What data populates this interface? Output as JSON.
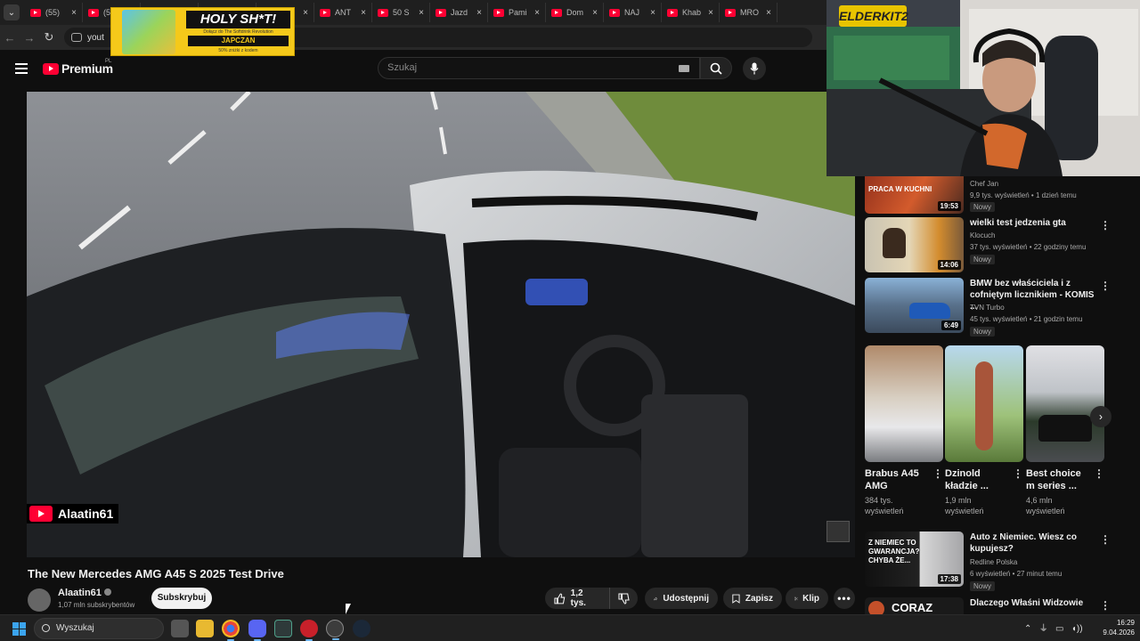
{
  "browser": {
    "tabs": [
      {
        "label": "(55)",
        "kind": "yt"
      },
      {
        "label": "(55)",
        "kind": "yt"
      },
      {
        "label": "",
        "kind": "audio"
      },
      {
        "label": "",
        "kind": "yt"
      },
      {
        "label": "Zbój",
        "kind": "yt"
      },
      {
        "label": "ANT",
        "kind": "yt"
      },
      {
        "label": "50 S",
        "kind": "yt"
      },
      {
        "label": "Jazd",
        "kind": "yt"
      },
      {
        "label": "Pami",
        "kind": "yt"
      },
      {
        "label": "Dom",
        "kind": "yt"
      },
      {
        "label": "NAJ",
        "kind": "yt"
      },
      {
        "label": "Khab",
        "kind": "yt"
      },
      {
        "label": "MRO",
        "kind": "yt"
      }
    ],
    "url": "yout"
  },
  "ad": {
    "headline": "HOLY SH*T!",
    "line1": "Dołącz do The Softdrink Revolution",
    "brand": "JAPCZAN",
    "line2": "50% zniżki z kodem"
  },
  "header": {
    "logo_text": "Premium",
    "logo_sup": "PL",
    "search_placeholder": "Szukaj"
  },
  "video": {
    "watermark_channel": "Alaatin61",
    "title": "The New Mercedes AMG A45 S 2025 Test Drive",
    "channel": "Alaatin61",
    "subscribers": "1,07 mln subskrybentów",
    "subscribe_label": "Subskrybuj",
    "likes": "1,2 tys.",
    "share_label": "Udostępnij",
    "save_label": "Zapisz",
    "clip_label": "Klip"
  },
  "sidebar": {
    "videos_top": [
      {
        "title": "",
        "channel": "Chef Jan",
        "meta": "9,9 tys. wyświetleń • 1 dzień temu",
        "badge": "Nowy",
        "duration": "19:53",
        "thumb_text": "PRACA W KUCHNI"
      },
      {
        "title": "wielki test jedzenia gta",
        "channel": "Klocuch",
        "meta": "37 tys. wyświetleń • 22 godziny temu",
        "badge": "Nowy",
        "duration": "14:06"
      },
      {
        "title": "BMW bez właściciela i z cofniętym licznikiem - KOMIS ...",
        "channel": "TVN Turbo",
        "meta": "45 tys. wyświetleń • 21 godzin temu",
        "badge": "Nowy",
        "duration": "6:49"
      }
    ],
    "shorts": [
      {
        "title": "Brabus A45 AMG",
        "views": "384 tys. wyświetleń"
      },
      {
        "title": "Dzinold kładzie ...",
        "views": "1,9 mln wyświetleń"
      },
      {
        "title": "Best choice m series ...",
        "views": "4,6 mln wyświetleń"
      }
    ],
    "videos_bottom": [
      {
        "title": "Auto z Niemiec. Wiesz co kupujesz?",
        "channel": "Redline Polska",
        "meta": "6 wyświetleń • 27 minut temu",
        "badge": "Nowy",
        "duration": "17:38",
        "thumb_text": "Z NIEMIEC TO GWARANCJA? CHYBA ŻE..."
      },
      {
        "title": "Dlaczego Właśni Widzowie",
        "channel": "",
        "meta": "",
        "badge": "",
        "duration": "",
        "thumb_text": "CORAZ"
      }
    ]
  },
  "webcam": {
    "logo": "ELDERKIT2"
  },
  "taskbar": {
    "search_label": "Wyszukaj",
    "time": "16:29",
    "date": "9.04.2026"
  }
}
